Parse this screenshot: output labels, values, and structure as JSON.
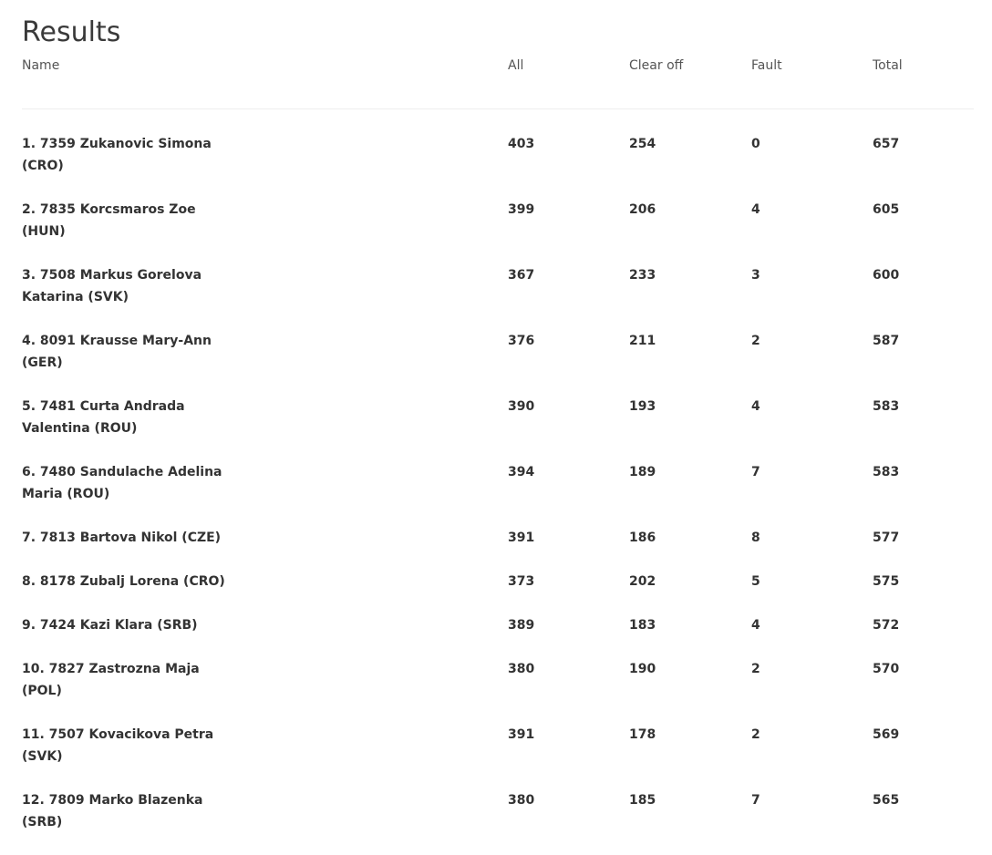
{
  "page": {
    "title": "Results"
  },
  "table": {
    "columns": {
      "name": "Name",
      "all": "All",
      "clear_off": "Clear off",
      "fault": "Fault",
      "total": "Total"
    },
    "rows": [
      {
        "name": "1. 7359 Zukanovic Simona (CRO)",
        "all": "403",
        "clear_off": "254",
        "fault": "0",
        "total": "657"
      },
      {
        "name": "2. 7835 Korcsmaros Zoe (HUN)",
        "all": "399",
        "clear_off": "206",
        "fault": "4",
        "total": "605"
      },
      {
        "name": "3. 7508 Markus Gorelova Katarina (SVK)",
        "all": "367",
        "clear_off": "233",
        "fault": "3",
        "total": "600"
      },
      {
        "name": "4. 8091 Krausse Mary-Ann (GER)",
        "all": "376",
        "clear_off": "211",
        "fault": "2",
        "total": "587"
      },
      {
        "name": "5. 7481 Curta Andrada Valentina (ROU)",
        "all": "390",
        "clear_off": "193",
        "fault": "4",
        "total": "583"
      },
      {
        "name": "6. 7480 Sandulache Adelina Maria (ROU)",
        "all": "394",
        "clear_off": "189",
        "fault": "7",
        "total": "583"
      },
      {
        "name": "7. 7813 Bartova Nikol (CZE)",
        "all": "391",
        "clear_off": "186",
        "fault": "8",
        "total": "577"
      },
      {
        "name": "8. 8178 Zubalj Lorena (CRO)",
        "all": "373",
        "clear_off": "202",
        "fault": "5",
        "total": "575"
      },
      {
        "name": "9. 7424 Kazi Klara (SRB)",
        "all": "389",
        "clear_off": "183",
        "fault": "4",
        "total": "572"
      },
      {
        "name": "10. 7827 Zastrozna Maja (POL)",
        "all": "380",
        "clear_off": "190",
        "fault": "2",
        "total": "570"
      },
      {
        "name": "11. 7507 Kovacikova Petra (SVK)",
        "all": "391",
        "clear_off": "178",
        "fault": "2",
        "total": "569"
      },
      {
        "name": "12. 7809 Marko Blazenka (SRB)",
        "all": "380",
        "clear_off": "185",
        "fault": "7",
        "total": "565"
      }
    ]
  }
}
